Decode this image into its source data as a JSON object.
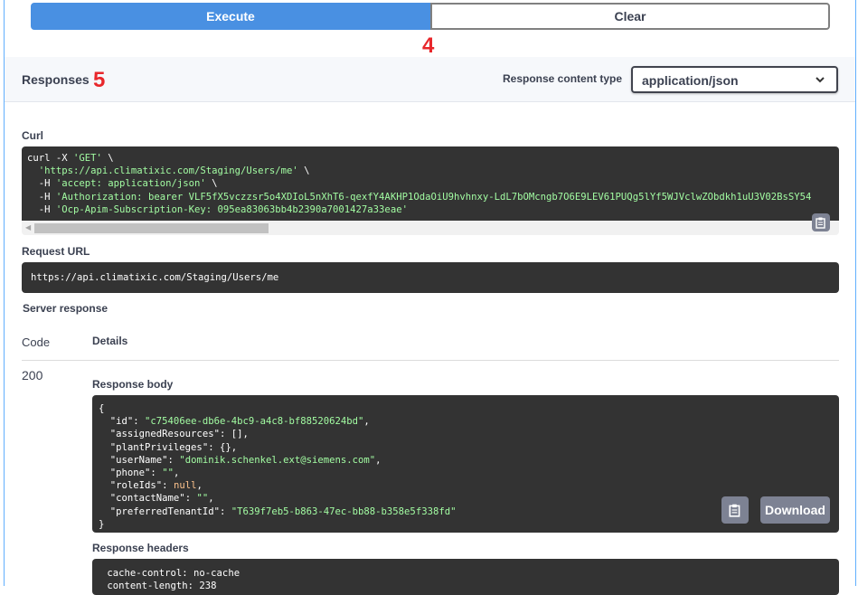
{
  "buttons": {
    "execute": "Execute",
    "clear": "Clear"
  },
  "annotations": {
    "four": "4",
    "five": "5"
  },
  "responses": {
    "title": "Responses",
    "content_type_label": "Response content type",
    "content_type_value": "application/json"
  },
  "curl": {
    "label": "Curl",
    "lines": [
      [
        "curl -X ",
        "'GET'",
        " \\"
      ],
      [
        "  ",
        "'https://api.climatixic.com/Staging/Users/me'",
        " \\"
      ],
      [
        "  -H ",
        "'accept: application/json'",
        " \\"
      ],
      [
        "  -H ",
        "'Authorization: bearer VLF5fX5vczzsr5o4XDIoL5nXhT6-qexfY4AKHP1OdaOiU9hvhnxy-LdL7bOMcngb7O6E9LEV61PUQg5lYf5WJVclwZObdkh1uU3V02BsSY54",
        ""
      ],
      [
        "  -H ",
        "'Ocp-Apim-Subscription-Key: 095ea83063bb4b2390a7001427a33eae'",
        ""
      ]
    ]
  },
  "request_url": {
    "label": "Request URL",
    "value": "https://api.climatixic.com/Staging/Users/me"
  },
  "server_response": {
    "label": "Server response",
    "col_code": "Code",
    "col_details": "Details",
    "code": "200",
    "body_label": "Response body",
    "body_lines": [
      {
        "pre": "{",
        "key": "",
        "val": "",
        "post": "",
        "cls": ""
      },
      {
        "pre": "  ",
        "key": "\"id\"",
        "val": "\"c75406ee-db6e-4bc9-a4c8-bf88520624bd\"",
        "post": ",",
        "cls": "str"
      },
      {
        "pre": "  ",
        "key": "\"assignedResources\"",
        "val": "[]",
        "post": ",",
        "cls": ""
      },
      {
        "pre": "  ",
        "key": "\"plantPrivileges\"",
        "val": "{}",
        "post": ",",
        "cls": ""
      },
      {
        "pre": "  ",
        "key": "\"userName\"",
        "val": "\"dominik.schenkel.ext@siemens.com\"",
        "post": ",",
        "cls": "str"
      },
      {
        "pre": "  ",
        "key": "\"phone\"",
        "val": "\"\"",
        "post": ",",
        "cls": "str"
      },
      {
        "pre": "  ",
        "key": "\"roleIds\"",
        "val": "null",
        "post": ",",
        "cls": "nul"
      },
      {
        "pre": "  ",
        "key": "\"contactName\"",
        "val": "\"\"",
        "post": ",",
        "cls": "str"
      },
      {
        "pre": "  ",
        "key": "\"preferredTenantId\"",
        "val": "\"T639f7eb5-b863-47ec-bb88-b358e5f338fd\"",
        "post": "",
        "cls": "str"
      },
      {
        "pre": "}",
        "key": "",
        "val": "",
        "post": "",
        "cls": ""
      }
    ],
    "download": "Download",
    "headers_label": "Response headers",
    "header_lines": [
      " cache-control: no-cache",
      " content-length: 238"
    ]
  },
  "icons": {
    "copy": "clipboard-icon",
    "chevron": "chevron-down-icon"
  },
  "colors": {
    "execute": "#4990e2",
    "code_bg": "#333333",
    "string": "#a2fca2",
    "null": "#fcc28c",
    "annotation": "#e8272b"
  }
}
